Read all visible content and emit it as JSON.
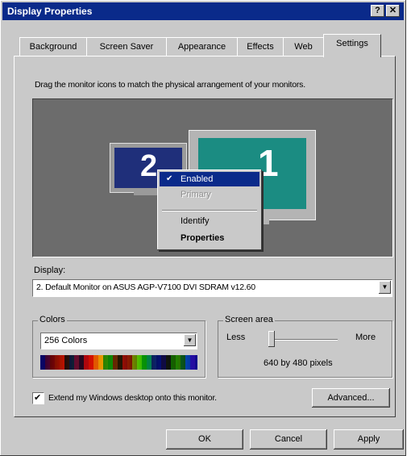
{
  "window": {
    "title": "Display Properties",
    "help_btn": "?",
    "close_btn": "✕"
  },
  "tabs": [
    {
      "label": "Background"
    },
    {
      "label": "Screen Saver"
    },
    {
      "label": "Appearance"
    },
    {
      "label": "Effects"
    },
    {
      "label": "Web"
    },
    {
      "label": "Settings"
    }
  ],
  "active_tab": "Settings",
  "instruction": "Drag the monitor icons to match the physical arrangement of your monitors.",
  "monitors": [
    {
      "number": "2",
      "color": "#1f2f7a"
    },
    {
      "number": "1",
      "color": "#1b8c82"
    }
  ],
  "context_menu": {
    "items": [
      {
        "label": "Enabled",
        "checked": true,
        "selected": true,
        "disabled": false,
        "bold": false
      },
      {
        "label": "Primary",
        "checked": false,
        "selected": false,
        "disabled": true,
        "bold": false
      },
      {
        "label": "Identify",
        "checked": false,
        "selected": false,
        "disabled": false,
        "bold": false
      },
      {
        "label": "Properties",
        "checked": false,
        "selected": false,
        "disabled": false,
        "bold": true
      }
    ],
    "check_glyph": "✔"
  },
  "display": {
    "label": "Display:",
    "value": "2. Default Monitor on ASUS AGP-V7100 DVI SDRAM v12.60"
  },
  "colors": {
    "label": "Colors",
    "value": "256 Colors"
  },
  "screen_area": {
    "label": "Screen area",
    "less": "Less",
    "more": "More",
    "resolution": "640 by 480 pixels",
    "level": 0
  },
  "extend_checkbox": {
    "label": "Extend my Windows desktop onto this monitor.",
    "checked": true,
    "check_glyph": "✔"
  },
  "buttons": {
    "advanced": "Advanced...",
    "ok": "OK",
    "cancel": "Cancel",
    "apply": "Apply"
  },
  "dropdown_arrow": "▼"
}
